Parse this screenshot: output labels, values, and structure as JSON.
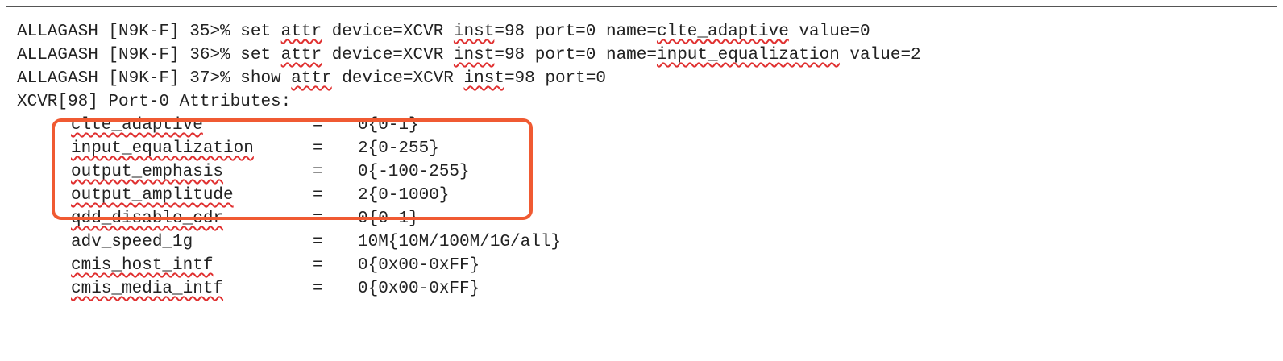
{
  "terminal": {
    "commands": [
      {
        "prompt": "ALLAGASH [N9K-F] 35>% ",
        "cmd": "set ",
        "attr_word": "attr",
        "mid1": " device=XCVR ",
        "inst_word": "inst",
        "mid2": "=98 port=0 name=",
        "name_value": "clte_adaptive",
        "tail": " value=0"
      },
      {
        "prompt": "ALLAGASH [N9K-F] 36>% ",
        "cmd": "set ",
        "attr_word": "attr",
        "mid1": " device=XCVR ",
        "inst_word": "inst",
        "mid2": "=98 port=0 name=",
        "name_value": "input_equalization",
        "tail": " value=2"
      },
      {
        "prompt": "ALLAGASH [N9K-F] 37>% ",
        "cmd": "show ",
        "attr_word": "attr",
        "mid1": " device=XCVR ",
        "inst_word": "inst",
        "mid2": "=98 port=0"
      }
    ],
    "header": "XCVR[98] Port-0 Attributes:",
    "attributes": [
      {
        "name": "clte_adaptive",
        "eq": "=",
        "value": "0{0-1}"
      },
      {
        "name": "input_equalization",
        "eq": "=",
        "value": "2{0-255}"
      },
      {
        "name": "output_emphasis",
        "eq": "=",
        "value": "0{-100-255}"
      },
      {
        "name": "output_amplitude",
        "eq": "=",
        "value": "2{0-1000}"
      },
      {
        "name": "qdd_disable_cdr",
        "eq": "=",
        "value": "0{0-1}"
      },
      {
        "name": "adv_speed_1g",
        "eq": "=",
        "value": "10M{10M/100M/1G/all}"
      },
      {
        "name": "cmis_host_intf",
        "eq": "=",
        "value": "0{0x00-0xFF}"
      },
      {
        "name": "cmis_media_intf",
        "eq": "=",
        "value": "0{0x00-0xFF}"
      }
    ],
    "colors": {
      "highlight": "#f05a32",
      "spellcheck": "#e03030",
      "text": "#222222"
    }
  }
}
